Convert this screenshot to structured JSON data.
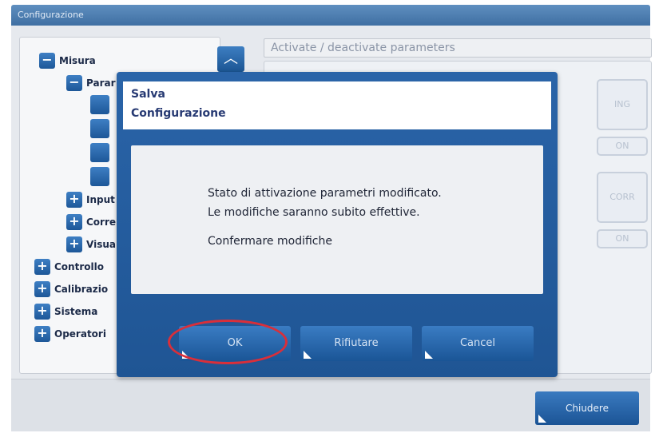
{
  "window": {
    "title": "Configurazione"
  },
  "tree": {
    "measure": "Misura",
    "params": "Parar",
    "inputs": "Input",
    "corrections": "Corre",
    "visual": "Visua",
    "control": "Controllo",
    "calibration": "Calibrazio",
    "system": "Sistema",
    "operators": "Operatori"
  },
  "params_panel": {
    "header": "Activate / deactivate parameters",
    "ghost_labels": [
      "ING",
      "ON",
      "CORR",
      "ON"
    ]
  },
  "dialog": {
    "title_line1": "Salva",
    "title_line2": "Configurazione",
    "message_line1": "Stato di attivazione parametri modificato.",
    "message_line2": "Le modifiche saranno subito effettive.",
    "message_line3": "Confermare modifiche",
    "ok_label": "OK",
    "refuse_label": "Rifiutare",
    "cancel_label": "Cancel"
  },
  "footer": {
    "close_label": "Chiudere"
  },
  "colors": {
    "primary_blue": "#1f5594",
    "highlight_red": "#d92f3a",
    "background": "#e6e9ee"
  }
}
